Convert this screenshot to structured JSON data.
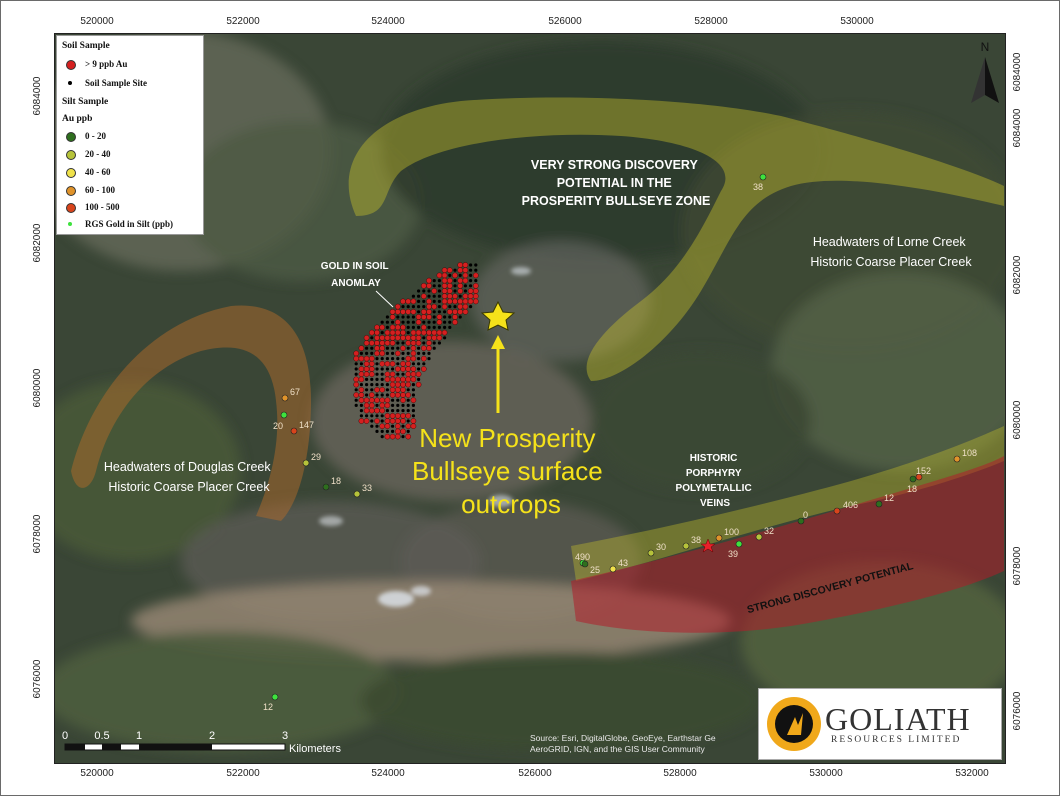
{
  "axes": {
    "x_ticks": [
      "520000",
      "522000",
      "524000",
      "526000",
      "528000",
      "530000",
      "532000"
    ],
    "y_ticks": [
      "6076000",
      "6078000",
      "6080000",
      "6082000",
      "6084000"
    ]
  },
  "legend": {
    "soil_heading": "Soil Sample",
    "soil_items": [
      {
        "label": "> 9 ppb Au",
        "color": "#d42020"
      },
      {
        "label": "Soil Sample Site",
        "color": "#000000"
      }
    ],
    "silt_heading": "Silt Sample",
    "silt_subheading": "Au ppb",
    "silt_items": [
      {
        "label": "0 - 20",
        "color": "#2e6e1e"
      },
      {
        "label": "20 - 40",
        "color": "#b6c33a"
      },
      {
        "label": "40 - 60",
        "color": "#f0e24a"
      },
      {
        "label": "60 - 100",
        "color": "#e0932a"
      },
      {
        "label": "100 - 500",
        "color": "#d8441c"
      },
      {
        "label": "RGS Gold in Silt (ppb)",
        "color": "#3ee23e"
      }
    ]
  },
  "labels": {
    "bullseye_zone": [
      "VERY STRONG DISCOVERY",
      "POTENTIAL IN THE",
      "PROSPERITY BULLSEYE ZONE"
    ],
    "lorne": [
      "Headwaters of Lorne Creek",
      "Historic Coarse Placer Creek"
    ],
    "douglas": [
      "Headwaters of Douglas Creek",
      "Historic Coarse Placer Creek"
    ],
    "soil_anomaly": [
      "GOLD IN SOIL",
      "ANOMLAY"
    ],
    "new_prosperity": [
      "New Prosperity",
      "Bullseye surface",
      "outcrops"
    ],
    "porphyry": [
      "HISTORIC",
      "PORPHYRY",
      "POLYMETALLIC",
      "VEINS"
    ],
    "strong_potential": "STRONG DISCOVERY POTENTIAL"
  },
  "samples": [
    {
      "value": "38",
      "color": "#3ee23e"
    },
    {
      "value": "67",
      "color": "#e0932a"
    },
    {
      "value": "20",
      "color": "#3ee23e"
    },
    {
      "value": "147",
      "color": "#d8441c"
    },
    {
      "value": "29",
      "color": "#b6c33a"
    },
    {
      "value": "18",
      "color": "#2e6e1e"
    },
    {
      "value": "33",
      "color": "#b6c33a"
    },
    {
      "value": "490",
      "color": "#3ee23e"
    },
    {
      "value": "25",
      "color": "#2e6e1e"
    },
    {
      "value": "43",
      "color": "#f0e24a"
    },
    {
      "value": "30",
      "color": "#b6c33a"
    },
    {
      "value": "38",
      "color": "#b6c33a"
    },
    {
      "value": "100",
      "color": "#e0932a"
    },
    {
      "value": "39",
      "color": "#3ee23e"
    },
    {
      "value": "32",
      "color": "#b6c33a"
    },
    {
      "value": "0",
      "color": "#2e6e1e"
    },
    {
      "value": "406",
      "color": "#d8441c"
    },
    {
      "value": "12",
      "color": "#2e6e1e"
    },
    {
      "value": "18",
      "color": "#2e6e1e"
    },
    {
      "value": "152",
      "color": "#d8441c"
    },
    {
      "value": "108",
      "color": "#e0932a"
    },
    {
      "value": "12",
      "color": "#3ee23e"
    }
  ],
  "scale_bar": {
    "ticks": [
      "0",
      "0.5",
      "1",
      "2",
      "3"
    ],
    "unit": "Kilometers"
  },
  "north": "N",
  "credits": [
    "Source: Esri, DigitalGlobe, GeoEye, Earthstar Ge",
    "AeroGRID, IGN, and the GIS User Community"
  ],
  "logo": {
    "name": "GOLIATH",
    "subtitle": "RESOURCES LIMITED"
  },
  "colors": {
    "bullseye_zone": "#c8c22a",
    "placer_band": "#b06a2a",
    "strong_potential": "#b01e2a",
    "star": "#f5e21a",
    "soil_high": "#d42020"
  }
}
